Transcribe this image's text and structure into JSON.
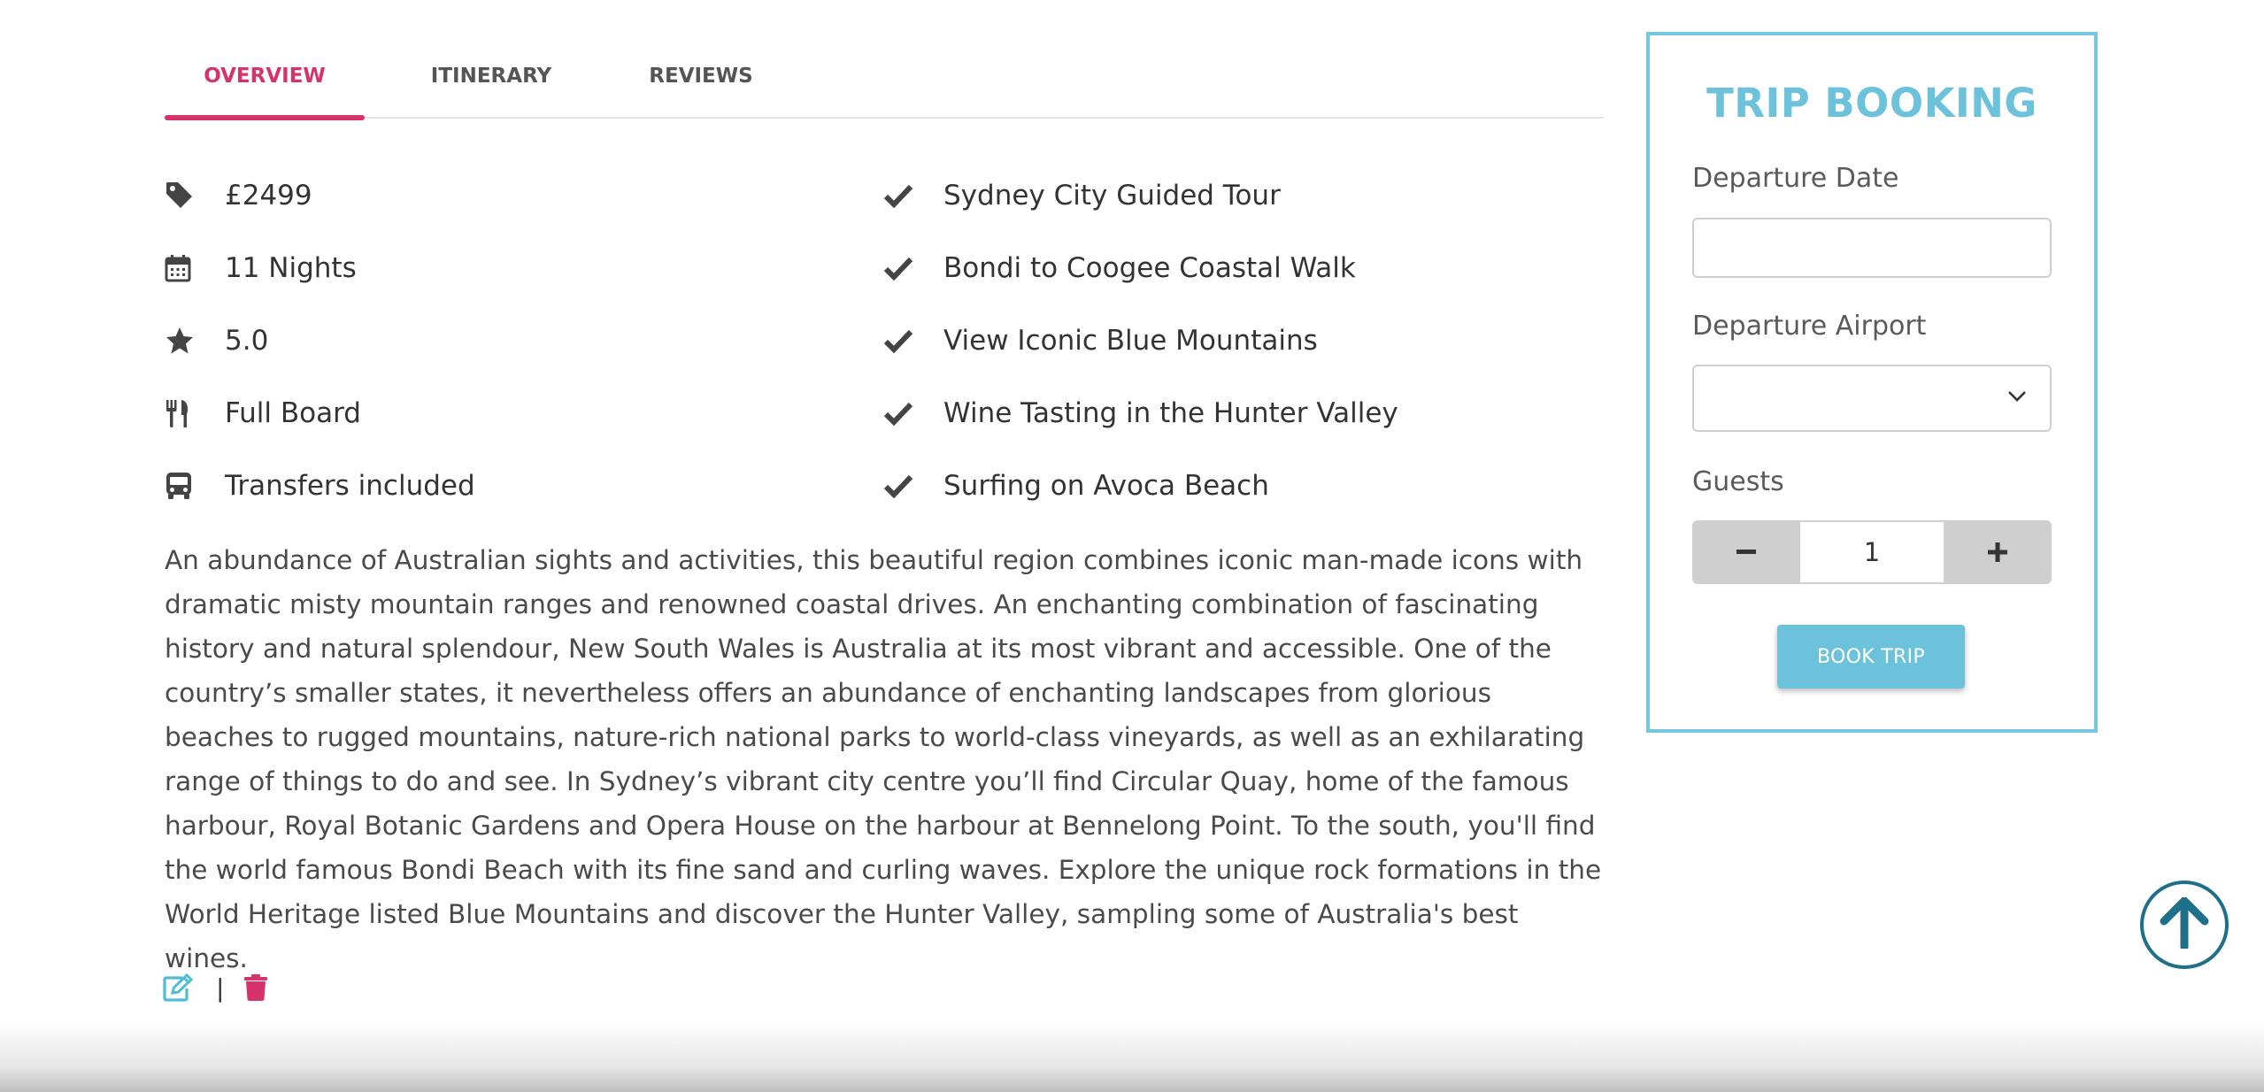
{
  "tabs": [
    {
      "label": "OVERVIEW",
      "active": true
    },
    {
      "label": "ITINERARY",
      "active": false
    },
    {
      "label": "REVIEWS",
      "active": false
    }
  ],
  "facts": [
    {
      "icon": "price-tag-icon",
      "text": "£2499"
    },
    {
      "icon": "calendar-icon",
      "text": "11 Nights"
    },
    {
      "icon": "star-icon",
      "text": "5.0"
    },
    {
      "icon": "cutlery-icon",
      "text": "Full Board"
    },
    {
      "icon": "bus-icon",
      "text": "Transfers included"
    }
  ],
  "highlights": [
    {
      "icon": "check-icon",
      "text": "Sydney City Guided Tour"
    },
    {
      "icon": "check-icon",
      "text": "Bondi to Coogee Coastal Walk"
    },
    {
      "icon": "check-icon",
      "text": "View Iconic Blue Mountains"
    },
    {
      "icon": "check-icon",
      "text": "Wine Tasting in the Hunter Valley"
    },
    {
      "icon": "check-icon",
      "text": "Surfing on Avoca Beach"
    }
  ],
  "description": "An abundance of Australian sights and activities, this beautiful region combines iconic man-made icons with dramatic misty mountain ranges and renowned coastal drives. An enchanting combination of fascinating history and natural splendour, New South Wales is Australia at its most vibrant and accessible. One of the country’s smaller states, it nevertheless offers an abundance of enchanting landscapes from glorious beaches to rugged mountains, nature-rich national parks to world-class vineyards, as well as an exhilarating range of things to do and see. In Sydney’s vibrant city centre you’ll find Circular Quay, home of the famous harbour, Royal Botanic Gardens and Opera House on the harbour at Bennelong Point. To the south, you'll find the world famous Bondi Beach with its fine sand and curling waves. Explore the unique rock formations in the World Heritage listed Blue Mountains and discover the Hunter Valley, sampling some of Australia's best wines.",
  "actions": {
    "edit_icon": "edit-icon",
    "separator": "|",
    "delete_icon": "trash-icon"
  },
  "booking": {
    "title": "TRIP BOOKING",
    "departure_date_label": "Departure Date",
    "departure_date_value": "",
    "departure_airport_label": "Departure Airport",
    "departure_airport_value": "",
    "guests_label": "Guests",
    "guests_value": "1",
    "book_button": "BOOK TRIP"
  },
  "colors": {
    "accent_pink": "#d6336c",
    "accent_teal": "#6cc2da",
    "scroll_top_blue": "#1e6f8a"
  },
  "scroll_top_icon": "arrow-up-icon"
}
